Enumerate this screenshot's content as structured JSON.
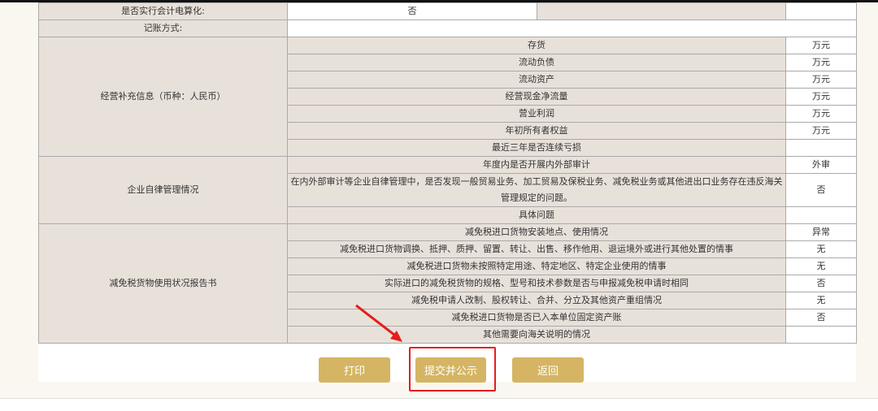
{
  "rows_top": [
    {
      "label": "是否实行会计电算化:",
      "value": "否"
    },
    {
      "label": "记账方式:",
      "value": ""
    }
  ],
  "sections": [
    {
      "title": "经营补充信息（币种：人民币）",
      "items": [
        {
          "label": "存货",
          "value": "万元"
        },
        {
          "label": "流动负债",
          "value": "万元"
        },
        {
          "label": "流动资产",
          "value": "万元"
        },
        {
          "label": "经营现金净流量",
          "value": "万元"
        },
        {
          "label": "营业利润",
          "value": "万元"
        },
        {
          "label": "年初所有者权益",
          "value": "万元"
        },
        {
          "label": "最近三年是否连续亏损",
          "value": ""
        }
      ]
    },
    {
      "title": "企业自律管理情况",
      "items": [
        {
          "label": "年度内是否开展内外部审计",
          "value": "外审"
        },
        {
          "label": "在内外部审计等企业自律管理中，是否发现一般贸易业务、加工贸易及保税业务、减免税业务或其他进出口业务存在违反海关管理规定的问题。",
          "value": "否"
        },
        {
          "label": "具体问题",
          "value": ""
        }
      ]
    },
    {
      "title": "减免税货物使用状况报告书",
      "items": [
        {
          "label": "减免税进口货物安装地点、使用情况",
          "value": "异常"
        },
        {
          "label": "减免税进口货物调换、抵押、质押、留置、转让、出售、移作他用、退运境外或进行其他处置的情事",
          "value": "无"
        },
        {
          "label": "减免税进口货物未按照特定用途、特定地区、特定企业使用的情事",
          "value": "无"
        },
        {
          "label": "实际进口的减免税货物的规格、型号和技术参数是否与申报减免税申请时相同",
          "value": "否"
        },
        {
          "label": "减免税申请人改制、股权转让、合并、分立及其他资产重组情况",
          "value": "无"
        },
        {
          "label": "减免税进口货物是否已入本单位固定资产账",
          "value": "否"
        },
        {
          "label": "其他需要向海关说明的情况",
          "value": ""
        }
      ]
    }
  ],
  "buttons": {
    "print": "打印",
    "submit": "提交并公示",
    "back": "返回"
  },
  "colors": {
    "accent": "#d5b563",
    "highlight": "#e51d1d"
  }
}
